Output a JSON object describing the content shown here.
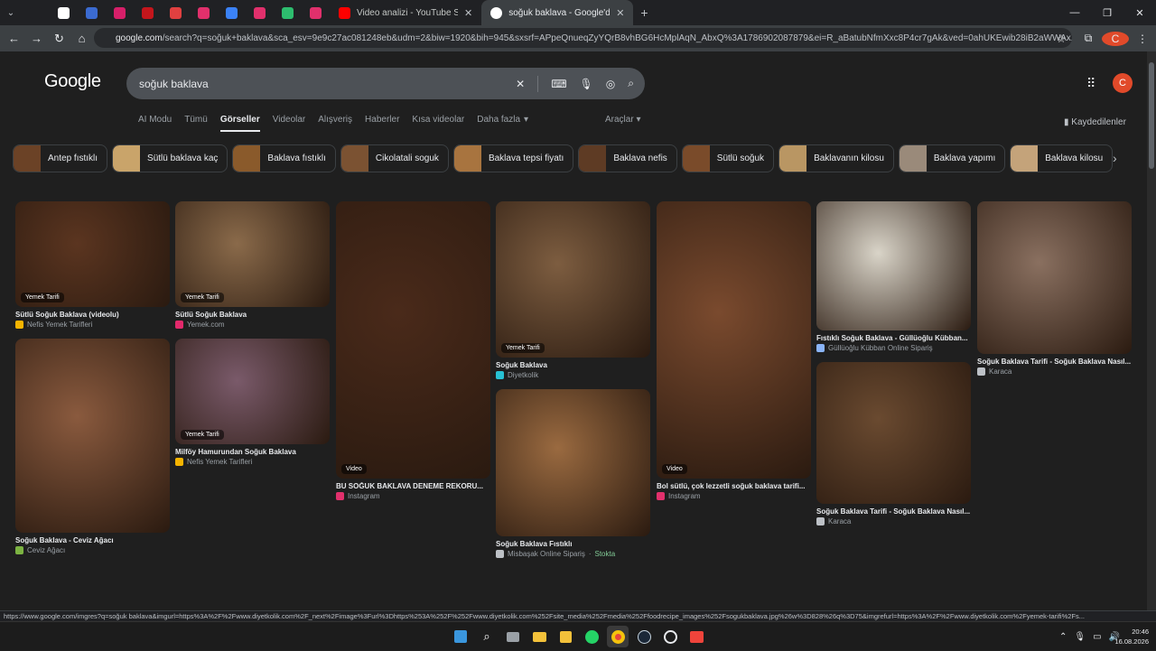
{
  "browser": {
    "tabs": [
      {
        "title": "Video analizi - YouTube Studio",
        "favicon_color": "#ff0000"
      },
      {
        "title": "soğuk baklava - Google'da Ara",
        "favicon_color": "#ffffff",
        "active": true
      }
    ],
    "pinned_favicons": [
      "#202124",
      "#ffffff",
      "#3b6bd1",
      "#d61f69",
      "#c4161c",
      "#e04040",
      "#e1306c",
      "#3b82f6",
      "#e1306c",
      "#2dbd6e",
      "#e1306c"
    ],
    "url_host": "google.com",
    "url_rest": "/search?q=soğuk+baklava&sca_esv=9e9c27ac081248eb&udm=2&biw=1920&bih=945&sxsrf=APpeQnueqZyYQrB8vhBG6HcMplAqN_AbxQ%3A1786902087879&ei=R_aBatubNfmXxc8P4cr7gAk&ved=0ahUKEwib28iB2aWWAxX5S_EDHW...",
    "profile_letter": "C"
  },
  "google": {
    "logo": "Google",
    "query": "soğuk baklava",
    "avatar_letter": "C",
    "nav_tabs": [
      "AI Modu",
      "Tümü",
      "Görseller",
      "Videolar",
      "Alışveriş",
      "Haberler",
      "Kısa videolar",
      "Daha fazla"
    ],
    "selected_tab": "Görseller",
    "tools": "Araçlar",
    "saved": "Kaydedilenler",
    "chips": [
      {
        "label": "Antep fıstıklı",
        "color": "#6b4226"
      },
      {
        "label": "Sütlü baklava kaç",
        "color": "#c9a46a"
      },
      {
        "label": "Baklava fıstıklı",
        "color": "#8a5a2b"
      },
      {
        "label": "Cikolatali soguk",
        "color": "#7b5232"
      },
      {
        "label": "Baklava tepsi fiyatı",
        "color": "#a8743f"
      },
      {
        "label": "Baklava nefis",
        "color": "#5e3b24"
      },
      {
        "label": "Sütlü soğuk",
        "color": "#7a4b2a"
      },
      {
        "label": "Baklavanın kilosu",
        "color": "#b99663"
      },
      {
        "label": "Baklava yapımı",
        "color": "#9a8a7a"
      },
      {
        "label": "Baklava kilosu",
        "color": "#c4a37a"
      }
    ],
    "results": [
      {
        "title": "Sütlü Soğuk Baklava (videolu)",
        "source": "Nefis Yemek Tarifleri",
        "badge": "Yemek Tarifi",
        "color": "#5b3520",
        "src_color": "#f5b400"
      },
      {
        "title": "Sütlü Soğuk Baklava",
        "source": "Yemek.com",
        "badge": "Yemek Tarifi",
        "color": "#8a6a4a",
        "src_color": "#e2296b"
      },
      {
        "title": "BU SOĞUK BAKLAVA DENEME REKORU...",
        "source": "Instagram",
        "badge": "Video",
        "color": "#4a2a1a",
        "src_color": "#e1306c"
      },
      {
        "title": "Soğuk Baklava",
        "source": "Diyetkolik",
        "badge": "Yemek Tarifi",
        "color": "#7d5d40",
        "src_color": "#27c1d4"
      },
      {
        "title": "Bol sütlü, çok lezzetli soğuk baklava tarifi...",
        "source": "Instagram",
        "badge": "Video",
        "color": "#7a4a2e",
        "src_color": "#e1306c"
      },
      {
        "title": "Fıstıklı Soğuk Baklava - Güllüoğlu Kübban...",
        "source": "Güllüoğlu Kübban Online Sipariş",
        "badge": "",
        "color": "#d9d4c8",
        "src_color": "#8ab4f8"
      },
      {
        "title": "Soğuk Baklava Tarifi - Soğuk Baklava Nasıl...",
        "source": "Karaca",
        "badge": "",
        "color": "#8a7060",
        "src_color": "#bdc1c6"
      },
      {
        "title": "Soğuk Baklava - Ceviz Ağacı",
        "source": "Ceviz Ağacı",
        "badge": "",
        "color": "#8a5a3e",
        "src_color": "#7cb342"
      },
      {
        "title": "Milföy Hamurundan Soğuk Baklava",
        "source": "Nefis Yemek Tarifleri",
        "badge": "Yemek Tarifi",
        "color": "#7a5a6a",
        "src_color": "#f5b400"
      },
      {
        "title": "Soğuk Baklava Fıstıklı",
        "source": "Misbaşak Online Sipariş",
        "stock": "Stokta",
        "badge": "",
        "color": "#9a6a40",
        "src_color": "#bdc1c6"
      },
      {
        "title": "Soğuk Baklava Tarifi - Soğuk Baklava Nasıl...",
        "source": "Karaca",
        "badge": "",
        "color": "#6a4a30",
        "src_color": "#bdc1c6"
      }
    ]
  },
  "status_url": "https://www.google.com/imgres?q=soğuk baklava&imgurl=https%3A%2F%2Fwww.diyetkolik.com%2F_next%2Fimage%3Furl%3Dhttps%253A%252F%252Fwww.diyetkolik.com%252Fsite_media%252Fmedia%252Ffoodrecipe_images%252Fsogukbaklava.jpg%26w%3D828%26q%3D75&imgrefurl=https%3A%2F%2Fwww.diyetkolik.com%2Fyemek-tarifi%2Fs...",
  "clock": {
    "time": "20:46",
    "date": "16.08.2026"
  }
}
